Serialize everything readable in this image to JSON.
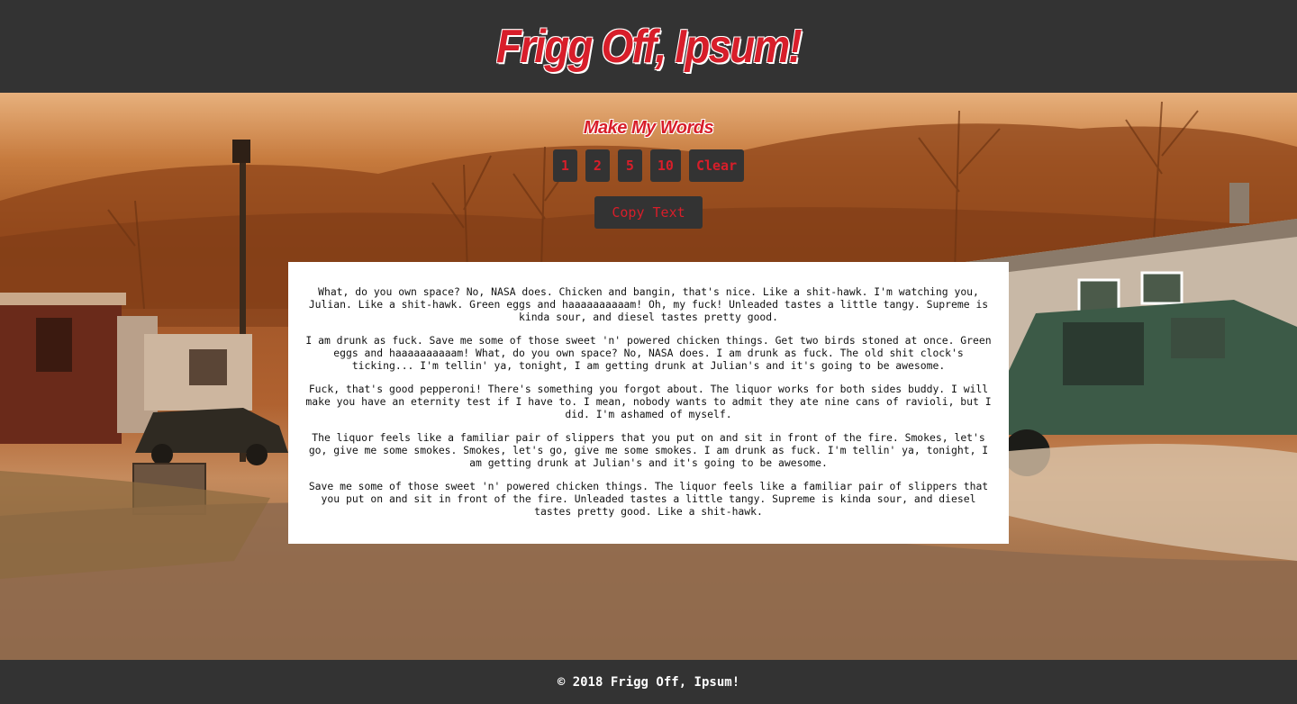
{
  "header": {
    "title": "Frigg Off, Ipsum!"
  },
  "controls": {
    "title": "Make My Words",
    "buttons": [
      "1",
      "2",
      "5",
      "10",
      "Clear"
    ],
    "copy_label": "Copy Text"
  },
  "content": {
    "paragraphs": [
      "What, do you own space? No, NASA does. Chicken and bangin, that's nice. Like a shit-hawk. I'm watching you, Julian. Like a shit-hawk. Green eggs and haaaaaaaaaam! Oh, my fuck! Unleaded tastes a little tangy. Supreme is kinda sour, and diesel tastes pretty good.",
      "I am drunk as fuck. Save me some of those sweet 'n' powered chicken things. Get two birds stoned at once. Green eggs and haaaaaaaaaam! What, do you own space? No, NASA does. I am drunk as fuck. The old shit clock's ticking... I'm tellin' ya, tonight, I am getting drunk at Julian's and it's going to be awesome.",
      "Fuck, that's good pepperoni! There's something you forgot about. The liquor works for both sides buddy. I will make you have an eternity test if I have to. I mean, nobody wants to admit they ate nine cans of ravioli, but I did. I'm ashamed of myself.",
      "The liquor feels like a familiar pair of slippers that you put on and sit in front of the fire. Smokes, let's go, give me some smokes. Smokes, let's go, give me some smokes. I am drunk as fuck. I'm tellin' ya, tonight, I am getting drunk at Julian's and it's going to be awesome.",
      "Save me some of those sweet 'n' powered chicken things. The liquor feels like a familiar pair of slippers that you put on and sit in front of the fire. Unleaded tastes a little tangy. Supreme is kinda sour, and diesel tastes pretty good. Like a shit-hawk."
    ]
  },
  "footer": {
    "text": "© 2018 Frigg Off, Ipsum!"
  },
  "colors": {
    "accent": "#d81e2a",
    "bar_background": "#333333",
    "text_box_background": "#ffffff"
  }
}
